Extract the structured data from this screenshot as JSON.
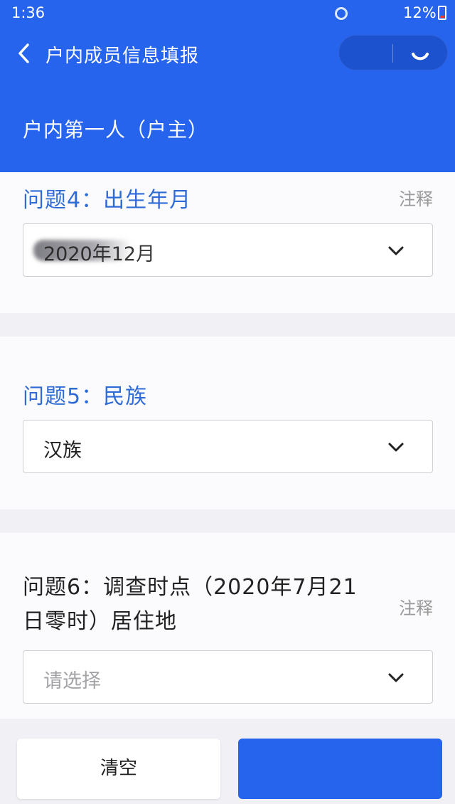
{
  "status_bar": {
    "time": "1:36",
    "battery": "12%"
  },
  "nav": {
    "title": "户内成员信息填报"
  },
  "person_label": "户内第一人（户主）",
  "note_label": "注释",
  "questions": [
    {
      "title": "问题4：出生年月",
      "value": "2020年12月"
    },
    {
      "title": "问题5：民族",
      "value": "汉族"
    },
    {
      "title": "问题6：调查时点（2020年7月21日零时）居住地",
      "placeholder": "请选择"
    }
  ],
  "footer": {
    "clear_label": "清空",
    "next_label": ""
  },
  "colors": {
    "primary": "#2764ee",
    "question_blue": "#2f6bd6"
  },
  "icons": {
    "back": "chevron-left-icon",
    "select": "chevron-down-icon",
    "more": "more-dots-icon",
    "close": "capsule-close-icon"
  }
}
